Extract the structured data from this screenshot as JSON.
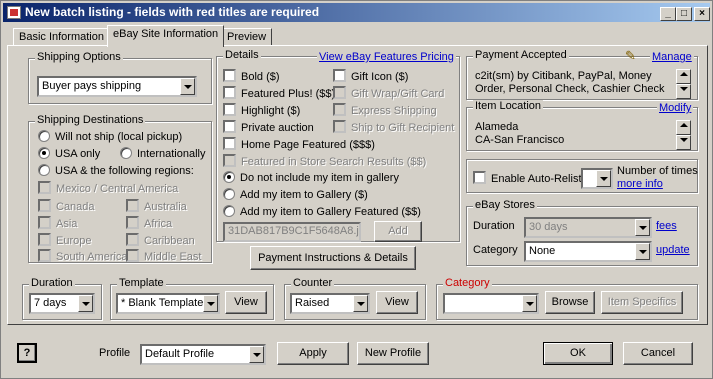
{
  "window": {
    "title": "New batch listing - fields with red titles are required"
  },
  "title_buttons": [
    "_",
    "□",
    "×"
  ],
  "tabs": [
    "Basic Information",
    "eBay Site Information",
    "Preview"
  ],
  "shipping_options": {
    "label": "Shipping Options",
    "value": "Buyer pays shipping"
  },
  "shipping_destinations": {
    "label": "Shipping Destinations",
    "will_not_ship": "Will not ship (local pickup)",
    "usa_only": "USA only",
    "internationally": "Internationally",
    "usa_following": "USA & the following regions:",
    "regions": [
      "Mexico / Central America",
      "Canada",
      "Australia",
      "Asia",
      "Africa",
      "Europe",
      "Caribbean",
      "South America",
      "Middle East"
    ]
  },
  "details": {
    "label": "Details",
    "features_link": "View eBay Features Pricing",
    "bold": "Bold ($)",
    "gift_icon": "Gift Icon ($)",
    "featured_plus": "Featured Plus! ($$)",
    "gift_wrap": "Gift Wrap/Gift Card",
    "highlight": "Highlight ($)",
    "express_shipping": "Express Shipping",
    "private_auction": "Private auction",
    "ship_to_gift": "Ship to Gift Recipient",
    "home_page_featured": "Home Page Featured ($$$)",
    "featured_store": "Featured in Store Search Results ($$)",
    "gallery_none": "Do not include my item in gallery",
    "gallery_add": "Add my item to Gallery ($)",
    "gallery_featured": "Add my item to Gallery Featured ($$)",
    "gallery_value": "31DAB817B9C1F5648A8.jp",
    "add_button": "Add"
  },
  "payment_instructions_button": "Payment Instructions & Details",
  "payment_accepted": {
    "label": "Payment Accepted",
    "manage": "Manage",
    "text": "c2it(sm) by Citibank, PayPal, Money Order, Personal Check, Cashier Check"
  },
  "item_location": {
    "label": "Item Location",
    "modify": "Modify",
    "line1": "Alameda",
    "line2": "CA-San Francisco"
  },
  "auto_relist": {
    "label": "Enable Auto-Relist",
    "times_label": "Number of times",
    "more_info": "more info"
  },
  "ebay_stores": {
    "label": "eBay Stores",
    "duration_label": "Duration",
    "duration_value": "30 days",
    "fees": "fees",
    "category_label": "Category",
    "category_value": "None",
    "update": "update"
  },
  "duration": {
    "label": "Duration",
    "value": "7 days"
  },
  "template": {
    "label": "Template",
    "value": "* Blank Template",
    "view": "View"
  },
  "counter": {
    "label": "Counter",
    "value": "Raised",
    "view": "View"
  },
  "category": {
    "label": "Category",
    "value": "",
    "browse": "Browse",
    "item_specifics": "Item Specifics",
    "label_color": "#cc0000"
  },
  "footer": {
    "help": "?",
    "profile_label": "Profile",
    "profile_value": "Default Profile",
    "apply": "Apply",
    "new_profile": "New Profile",
    "ok": "OK",
    "cancel": "Cancel"
  }
}
